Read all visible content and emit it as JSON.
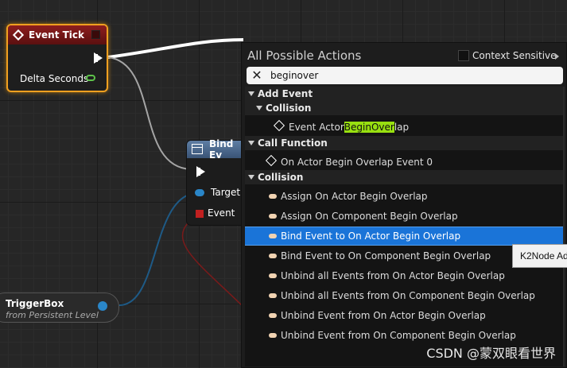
{
  "event_tick": {
    "title": "Event Tick",
    "param": "Delta Seconds"
  },
  "bind_node": {
    "title": "Bind Ev",
    "target": "Target",
    "event": "Event"
  },
  "trigger_box": {
    "title": "TriggerBox",
    "subtitle": "from Persistent Level"
  },
  "menu": {
    "title": "All Possible Actions",
    "context_sensitive": "Context Sensitive",
    "search_value": "beginover",
    "rows": [
      {
        "kind": "cat",
        "label": "Add Event"
      },
      {
        "kind": "subcat",
        "label": "Collision"
      },
      {
        "kind": "event",
        "pre": "Event Actor",
        "hl": "BeginOver",
        "post": "lap"
      },
      {
        "kind": "cat",
        "label": "Call Function"
      },
      {
        "kind": "func",
        "label": "On Actor Begin Overlap Event 0"
      },
      {
        "kind": "cat",
        "label": "Collision"
      },
      {
        "kind": "item",
        "label": "Assign On Actor Begin Overlap"
      },
      {
        "kind": "item",
        "label": "Assign On Component Begin Overlap"
      },
      {
        "kind": "item",
        "label": "Bind Event to On Actor Begin Overlap",
        "selected": true
      },
      {
        "kind": "item",
        "label": "Bind Event to On Component Begin Overlap"
      },
      {
        "kind": "item",
        "label": "Unbind all Events from On Actor Begin Overlap"
      },
      {
        "kind": "item",
        "label": "Unbind all Events from On Component Begin Overlap"
      },
      {
        "kind": "item",
        "label": "Unbind Event from On Actor Begin Overlap"
      },
      {
        "kind": "item",
        "label": "Unbind Event from On Component Begin Overlap"
      }
    ]
  },
  "tooltip": "K2Node Ad",
  "watermark": "CSDN @蒙双眼看世界",
  "colors": {
    "selection": "#1a74d8",
    "highlight": "#98e010",
    "tick_border": "#f0a020"
  }
}
